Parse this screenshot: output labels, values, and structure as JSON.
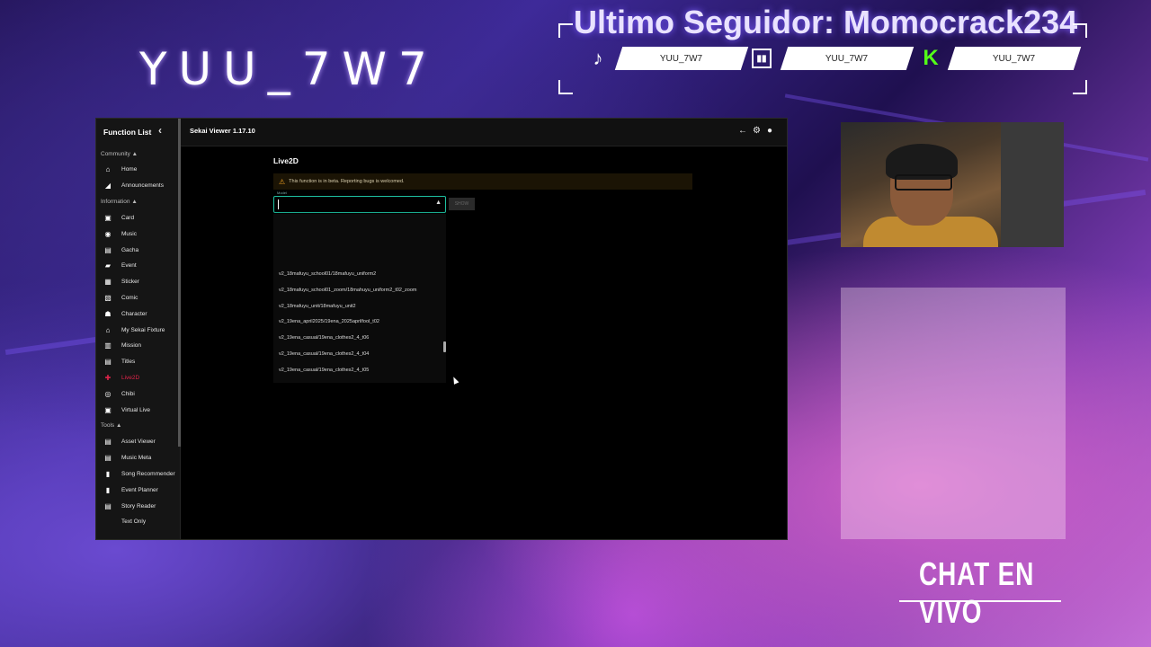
{
  "overlay": {
    "streamer_name": "YUU_7W7",
    "follower_title": "Ultimo Seguidor: Momocrack234",
    "socials": [
      {
        "platform_icon": "tiktok-icon",
        "handle": "YUU_7W7"
      },
      {
        "platform_icon": "twitch-icon",
        "handle": "YUU_7W7"
      },
      {
        "platform_icon": "kick-icon",
        "handle": "YUU_7W7"
      }
    ],
    "chat_title": "CHAT EN VIVO"
  },
  "app": {
    "sidebar": {
      "header": "Function List",
      "sections": [
        {
          "title": "Community ▲",
          "items": [
            {
              "label": "Home",
              "icon": "home-icon"
            },
            {
              "label": "Announcements",
              "icon": "announcement-icon"
            }
          ]
        },
        {
          "title": "Information ▲",
          "items": [
            {
              "label": "Card",
              "icon": "card-icon"
            },
            {
              "label": "Music",
              "icon": "music-icon"
            },
            {
              "label": "Gacha",
              "icon": "gacha-icon"
            },
            {
              "label": "Event",
              "icon": "event-icon"
            },
            {
              "label": "Sticker",
              "icon": "sticker-icon"
            },
            {
              "label": "Comic",
              "icon": "comic-icon"
            },
            {
              "label": "Character",
              "icon": "character-icon"
            },
            {
              "label": "My Sekai Fixture",
              "icon": "home-icon"
            },
            {
              "label": "Mission",
              "icon": "mission-icon"
            },
            {
              "label": "Titles",
              "icon": "titles-icon"
            },
            {
              "label": "Live2D",
              "icon": "live2d-icon",
              "active": true
            },
            {
              "label": "Chibi",
              "icon": "chibi-icon"
            },
            {
              "label": "Virtual Live",
              "icon": "virtual-live-icon"
            }
          ]
        },
        {
          "title": "Tools ▲",
          "items": [
            {
              "label": "Asset Viewer",
              "icon": "asset-icon"
            },
            {
              "label": "Music Meta",
              "icon": "music-meta-icon"
            },
            {
              "label": "Song Recommender",
              "icon": "recommender-icon"
            },
            {
              "label": "Event Planner",
              "icon": "planner-icon"
            },
            {
              "label": "Story Reader",
              "icon": "story-icon"
            },
            {
              "label": "Text Only",
              "icon": "text-icon"
            }
          ]
        }
      ]
    },
    "topbar": {
      "title": "Sekai Viewer 1.17.10"
    },
    "main": {
      "page_title": "Live2D",
      "beta_notice": "This function is in beta. Reporting bugs is welcomed.",
      "model_label": "Model",
      "show_button": "SHOW",
      "dropdown_items": [
        "v2_18mafuyu_school01/18mafuyu_uniform2",
        "v2_18mafuyu_school01_zoom/18mahuyu_uniform2_t02_zoom",
        "v2_18mafuyu_unit/18mafuyu_unit2",
        "v2_19ena_april2025/19ena_2025aprilfool_t02",
        "v2_19ena_casual/19ena_clothes2_4_t06",
        "v2_19ena_casual/19ena_clothes2_4_t04",
        "v2_19ena_casual/19ena_clothes2_4_t05"
      ]
    }
  }
}
